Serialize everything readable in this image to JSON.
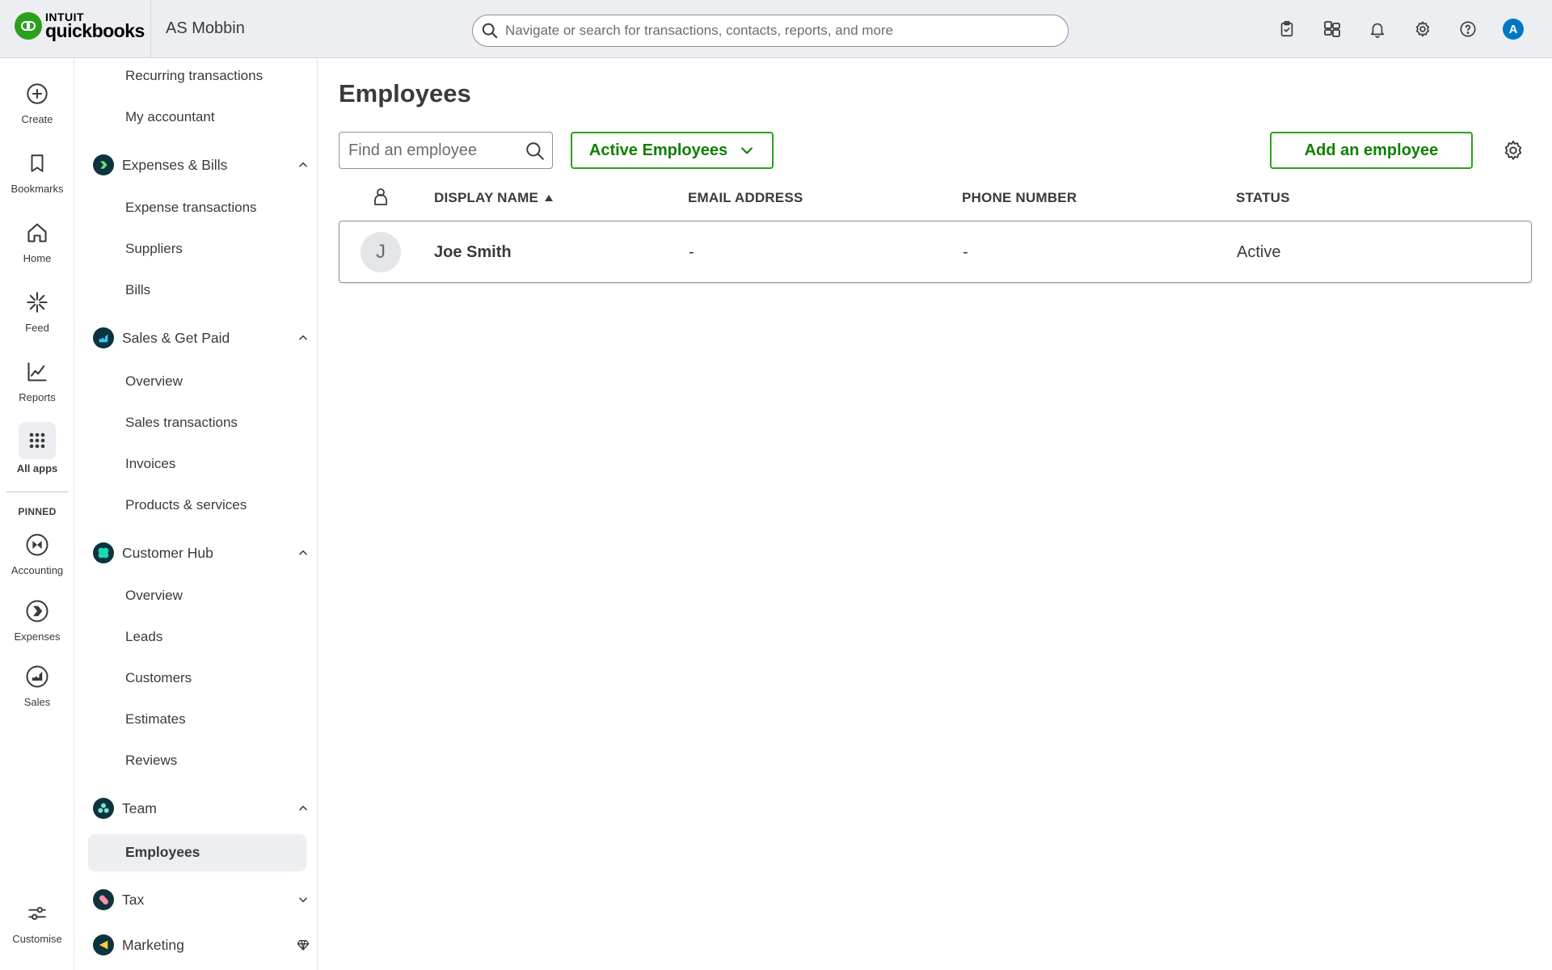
{
  "app": {
    "brand_top": "INTUIT",
    "brand_bottom": "quickbooks",
    "company": "AS Mobbin"
  },
  "search": {
    "placeholder": "Navigate or search for transactions, contacts, reports, and more"
  },
  "topbar_icons": [
    "clipboard-check-icon",
    "apps-switch-icon",
    "bell-icon",
    "gear-icon",
    "help-icon"
  ],
  "user": {
    "initial": "A"
  },
  "rail": {
    "items": [
      {
        "label": "Create",
        "icon": "plus-circle-icon"
      },
      {
        "label": "Bookmarks",
        "icon": "bookmark-icon"
      },
      {
        "label": "Home",
        "icon": "home-icon"
      },
      {
        "label": "Feed",
        "icon": "sparkle-icon"
      },
      {
        "label": "Reports",
        "icon": "line-chart-icon"
      },
      {
        "label": "All apps",
        "icon": "grid-dots-icon"
      }
    ],
    "pinned_label": "PINNED",
    "pinned": [
      {
        "label": "Accounting",
        "icon": "accounting-icon"
      },
      {
        "label": "Expenses",
        "icon": "expenses-icon"
      },
      {
        "label": "Sales",
        "icon": "sales-icon"
      }
    ],
    "customise": "Customise"
  },
  "nav": {
    "top_items": [
      "Recurring transactions",
      "My accountant"
    ],
    "sections": [
      {
        "label": "Expenses & Bills",
        "items": [
          "Expense transactions",
          "Suppliers",
          "Bills"
        ]
      },
      {
        "label": "Sales & Get Paid",
        "items": [
          "Overview",
          "Sales transactions",
          "Invoices",
          "Products & services"
        ]
      },
      {
        "label": "Customer Hub",
        "items": [
          "Overview",
          "Leads",
          "Customers",
          "Estimates",
          "Reviews"
        ]
      },
      {
        "label": "Team",
        "items": [
          "Employees"
        ]
      },
      {
        "label": "Tax"
      },
      {
        "label": "Marketing"
      }
    ]
  },
  "main": {
    "title": "Employees",
    "find_placeholder": "Find an employee",
    "filter_label": "Active Employees",
    "add_label": "Add an employee",
    "columns": [
      "DISPLAY NAME",
      "EMAIL ADDRESS",
      "PHONE NUMBER",
      "STATUS"
    ],
    "rows": [
      {
        "initial": "J",
        "name": "Joe Smith",
        "email": "-",
        "phone": "-",
        "status": "Active"
      }
    ]
  },
  "colors": {
    "brand_green": "#2ca01c",
    "button_text": "#108000",
    "nav_dark": "#0d333f",
    "avatar_blue": "#0077c5"
  }
}
